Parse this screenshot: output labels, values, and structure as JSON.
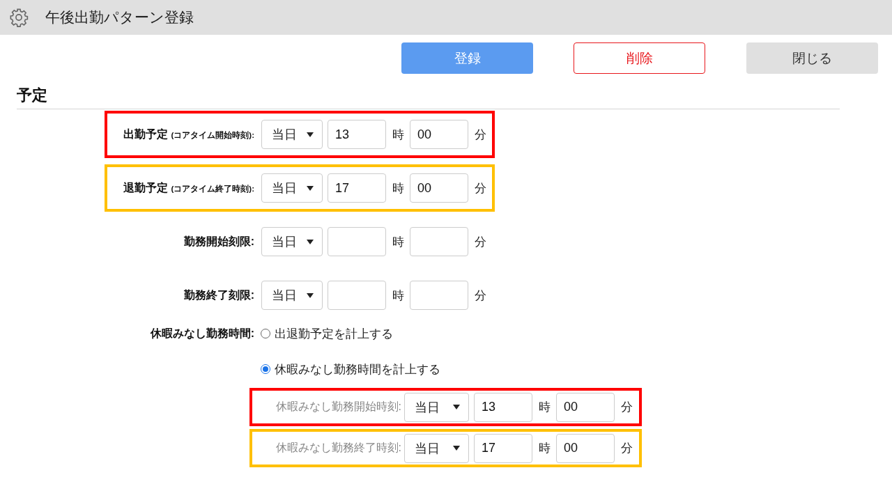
{
  "window": {
    "title": "午後出勤パターン登録"
  },
  "buttons": [
    {
      "label": "登録",
      "kind": "primary"
    },
    {
      "label": "削除",
      "kind": "danger"
    },
    {
      "label": "閉じる",
      "kind": "secondary"
    }
  ],
  "section": {
    "title": "予定"
  },
  "time_rows": [
    {
      "label": "出勤予定",
      "sub_label": "(コアタイム開始時刻):",
      "day": "当日",
      "hour": "13",
      "hour_unit": "時",
      "minute": "00",
      "minute_unit": "分",
      "color": "#ff0000"
    },
    {
      "label": "退勤予定",
      "sub_label": "(コアタイム終了時刻):",
      "day": "当日",
      "hour": "17",
      "hour_unit": "時",
      "minute": "00",
      "minute_unit": "分",
      "color": "#ffc000"
    },
    {
      "label": "勤務開始刻限:",
      "day": "当日",
      "hour_unit": "時",
      "minute_unit": "分"
    },
    {
      "label": "勤務終了刻限:",
      "day": "当日",
      "hour_unit": "時",
      "minute_unit": "分"
    }
  ],
  "leave_hours": {
    "label": "休暇みなし勤務時間:",
    "options": [
      {
        "label": "出退勤予定を計上する",
        "selected": false
      },
      {
        "label": "休暇みなし勤務時間を計上する",
        "selected": true
      }
    ]
  },
  "sub_rows": [
    {
      "label": "休暇みなし勤務開始時刻:",
      "day": "当日",
      "hour": "13",
      "hour_unit": "時",
      "minute": "00",
      "minute_unit": "分",
      "color": "#ff0000"
    },
    {
      "label": "休暇みなし勤務終了時刻:",
      "day": "当日",
      "hour": "17",
      "hour_unit": "時",
      "minute": "00",
      "minute_unit": "分",
      "color": "#ffc000"
    }
  ]
}
